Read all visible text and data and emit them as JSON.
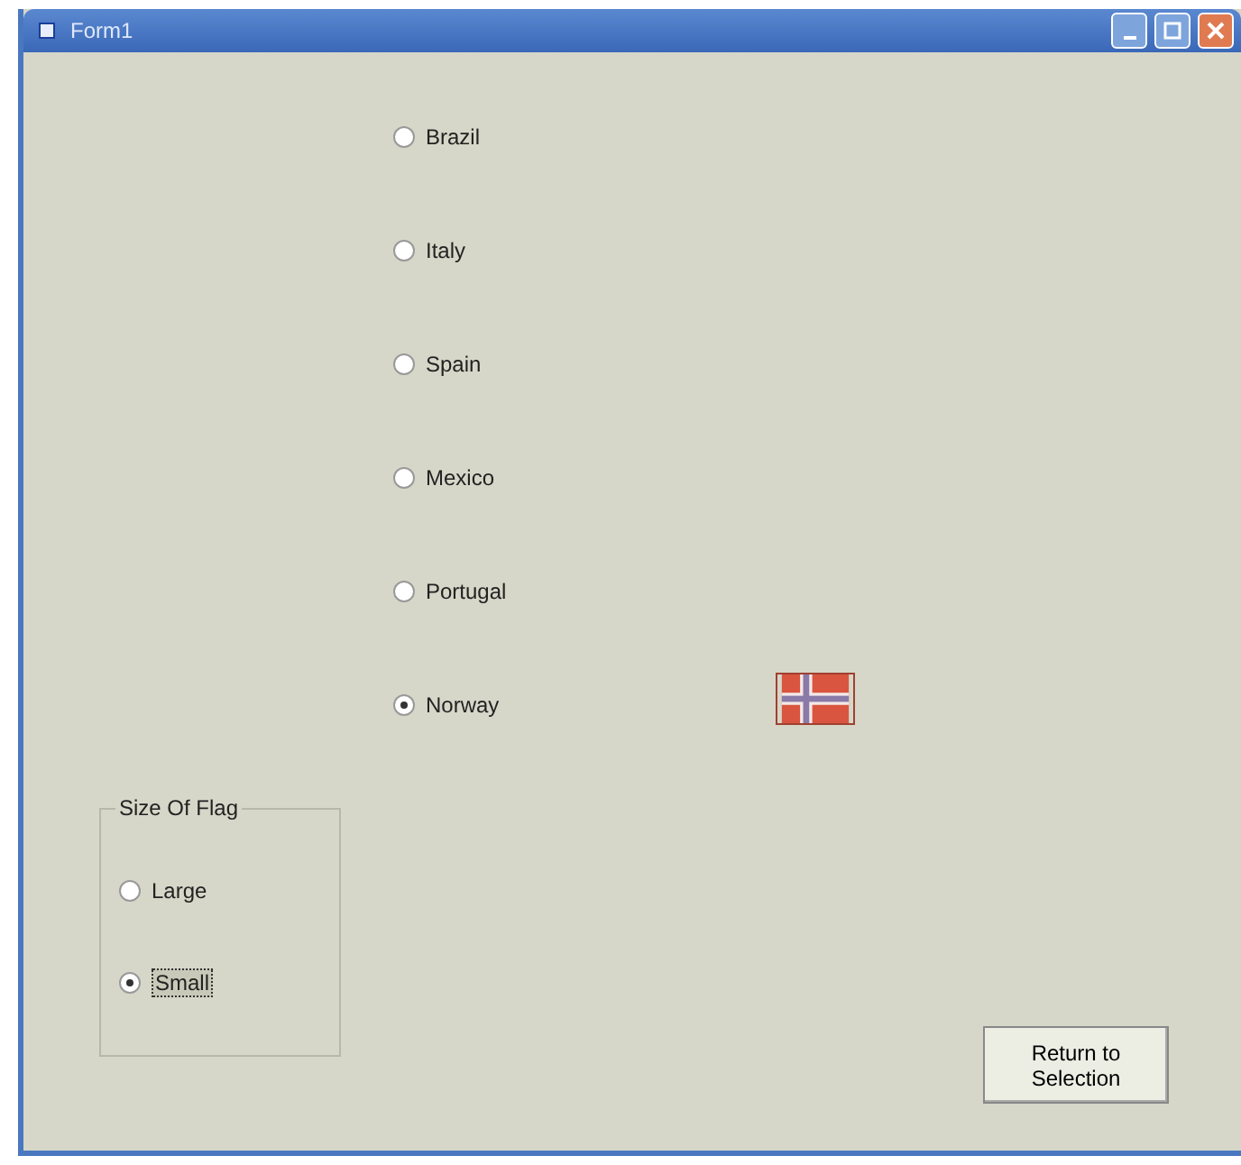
{
  "window": {
    "title": "Form1"
  },
  "countries": [
    {
      "label": "Brazil",
      "selected": false
    },
    {
      "label": "Italy",
      "selected": false
    },
    {
      "label": "Spain",
      "selected": false
    },
    {
      "label": "Mexico",
      "selected": false
    },
    {
      "label": "Portugal",
      "selected": false
    },
    {
      "label": "Norway",
      "selected": true
    }
  ],
  "size_group": {
    "title": "Size Of Flag",
    "options": [
      {
        "label": "Large",
        "selected": false,
        "focused": false
      },
      {
        "label": "Small",
        "selected": true,
        "focused": true
      }
    ]
  },
  "button": "Return to Selection"
}
